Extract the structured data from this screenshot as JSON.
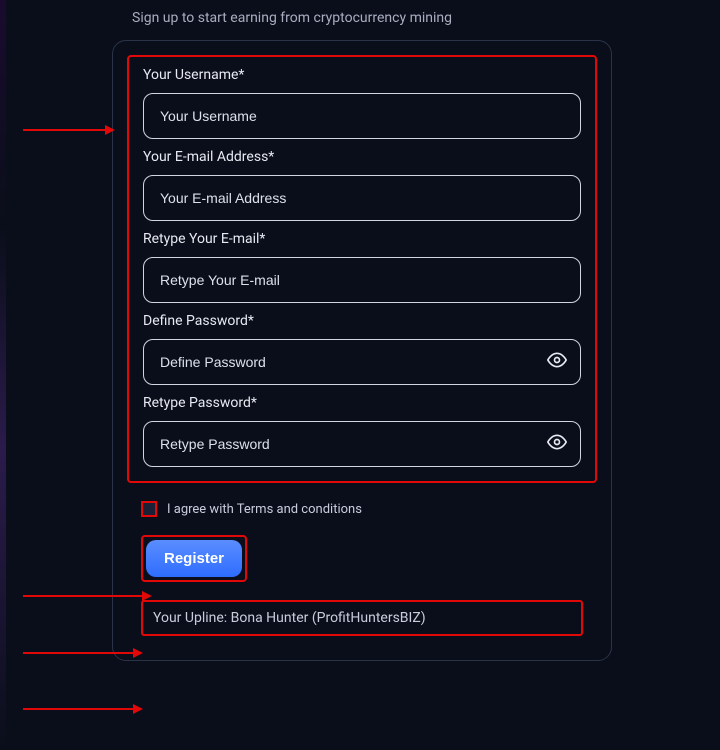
{
  "subtitle": "Sign up to start earning from cryptocurrency mining",
  "form": {
    "username": {
      "label": "Your Username*",
      "placeholder": "Your Username"
    },
    "email": {
      "label": "Your E-mail Address*",
      "placeholder": "Your E-mail Address"
    },
    "email2": {
      "label": "Retype Your E-mail*",
      "placeholder": "Retype Your E-mail"
    },
    "password": {
      "label": "Define Password*",
      "placeholder": "Define Password"
    },
    "password2": {
      "label": "Retype Password*",
      "placeholder": "Retype Password"
    }
  },
  "terms": {
    "label": "I agree with Terms and conditions"
  },
  "register_button": "Register",
  "upline": "Your Upline: Bona Hunter (ProfitHuntersBIZ)",
  "annotations": {
    "color": "#e20808"
  }
}
